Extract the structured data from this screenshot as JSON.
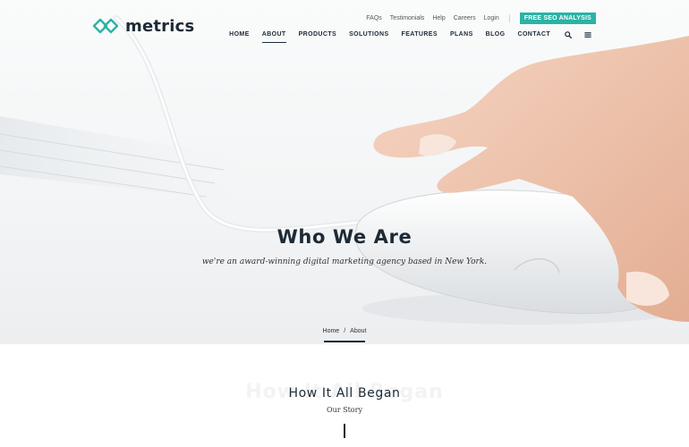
{
  "brand": {
    "name": "metrics",
    "accent": "#2ab3a6",
    "dark": "#1d2b36"
  },
  "topbar": {
    "links": [
      "FAQs",
      "Testimonials",
      "Help",
      "Careers",
      "Login"
    ],
    "cta": "FREE SEO ANALYSIS"
  },
  "nav": {
    "items": [
      "HOME",
      "ABOUT",
      "PRODUCTS",
      "SOLUTIONS",
      "FEATURES",
      "PLANS",
      "BLOG",
      "CONTACT"
    ],
    "active": "ABOUT",
    "icons": [
      "search-icon",
      "menu-icon"
    ]
  },
  "hero": {
    "title": "Who We Are",
    "subtitle": "we're an award-winning digital marketing agency based in New York.",
    "breadcrumb": {
      "home": "Home",
      "separator": "/",
      "current": "About"
    }
  },
  "section": {
    "background_word": "How It All Began",
    "title": "How It All Began",
    "subtitle": "Our Story"
  }
}
